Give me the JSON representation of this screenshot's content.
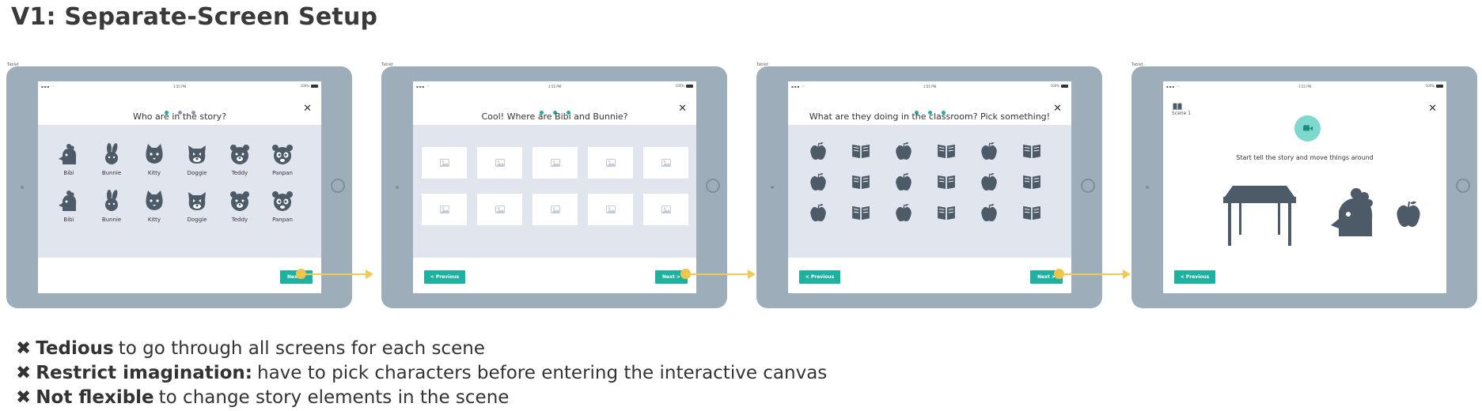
{
  "title": "V1: Separate-Screen Setup",
  "device_tag": "Tablet",
  "status_time": "3:55 PM",
  "status_battery": "100%",
  "colors": {
    "accent": "#1fb0a0",
    "tablet": "#9eadba",
    "panel": "#e1e6ee",
    "arrow": "#eecb55",
    "icon": "#4d5b68"
  },
  "screens": [
    {
      "question": "Who are in the story?",
      "next_label": "Next >",
      "characters": [
        {
          "name": "Bibi",
          "icon": "chicken-icon"
        },
        {
          "name": "Bunnie",
          "icon": "bunny-icon"
        },
        {
          "name": "Kitty",
          "icon": "cat-icon"
        },
        {
          "name": "Doggie",
          "icon": "dog-icon"
        },
        {
          "name": "Teddy",
          "icon": "bear-icon"
        },
        {
          "name": "Panpan",
          "icon": "panda-icon"
        },
        {
          "name": "Bibi",
          "icon": "chicken-icon"
        },
        {
          "name": "Bunnie",
          "icon": "bunny-icon"
        },
        {
          "name": "Kitty",
          "icon": "cat-icon"
        },
        {
          "name": "Doggie",
          "icon": "dog-icon"
        },
        {
          "name": "Teddy",
          "icon": "bear-icon"
        },
        {
          "name": "Panpan",
          "icon": "panda-icon"
        }
      ]
    },
    {
      "question": "Cool! Where are Bibi and Bunnie?",
      "prev_label": "< Previous",
      "next_label": "Next >",
      "placeholder_icon": "image-placeholder-icon"
    },
    {
      "question": "What are they doing in the classroom? Pick something!",
      "prev_label": "< Previous",
      "next_label": "Next >",
      "objects": [
        "apple-icon",
        "book-icon"
      ]
    },
    {
      "scene_label": "Scene 1",
      "instruction": "Start tell the story and move things around",
      "prev_label": "< Previous",
      "canvas_objects": [
        "desk-icon",
        "chicken-icon",
        "apple-icon"
      ]
    }
  ],
  "cons": [
    {
      "bold": "Tedious",
      "rest": "to go through all screens for each scene"
    },
    {
      "bold": "Restrict imagination:",
      "rest": "have to pick characters before entering the interactive canvas"
    },
    {
      "bold": "Not flexible",
      "rest": "to change story elements in the scene"
    }
  ]
}
